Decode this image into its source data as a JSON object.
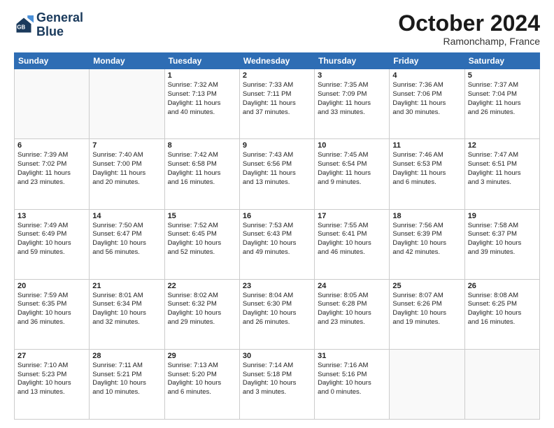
{
  "header": {
    "logo_line1": "General",
    "logo_line2": "Blue",
    "month": "October 2024",
    "location": "Ramonchamp, France"
  },
  "weekdays": [
    "Sunday",
    "Monday",
    "Tuesday",
    "Wednesday",
    "Thursday",
    "Friday",
    "Saturday"
  ],
  "weeks": [
    [
      {
        "day": "",
        "detail": ""
      },
      {
        "day": "",
        "detail": ""
      },
      {
        "day": "1",
        "detail": "Sunrise: 7:32 AM\nSunset: 7:13 PM\nDaylight: 11 hours\nand 40 minutes."
      },
      {
        "day": "2",
        "detail": "Sunrise: 7:33 AM\nSunset: 7:11 PM\nDaylight: 11 hours\nand 37 minutes."
      },
      {
        "day": "3",
        "detail": "Sunrise: 7:35 AM\nSunset: 7:09 PM\nDaylight: 11 hours\nand 33 minutes."
      },
      {
        "day": "4",
        "detail": "Sunrise: 7:36 AM\nSunset: 7:06 PM\nDaylight: 11 hours\nand 30 minutes."
      },
      {
        "day": "5",
        "detail": "Sunrise: 7:37 AM\nSunset: 7:04 PM\nDaylight: 11 hours\nand 26 minutes."
      }
    ],
    [
      {
        "day": "6",
        "detail": "Sunrise: 7:39 AM\nSunset: 7:02 PM\nDaylight: 11 hours\nand 23 minutes."
      },
      {
        "day": "7",
        "detail": "Sunrise: 7:40 AM\nSunset: 7:00 PM\nDaylight: 11 hours\nand 20 minutes."
      },
      {
        "day": "8",
        "detail": "Sunrise: 7:42 AM\nSunset: 6:58 PM\nDaylight: 11 hours\nand 16 minutes."
      },
      {
        "day": "9",
        "detail": "Sunrise: 7:43 AM\nSunset: 6:56 PM\nDaylight: 11 hours\nand 13 minutes."
      },
      {
        "day": "10",
        "detail": "Sunrise: 7:45 AM\nSunset: 6:54 PM\nDaylight: 11 hours\nand 9 minutes."
      },
      {
        "day": "11",
        "detail": "Sunrise: 7:46 AM\nSunset: 6:53 PM\nDaylight: 11 hours\nand 6 minutes."
      },
      {
        "day": "12",
        "detail": "Sunrise: 7:47 AM\nSunset: 6:51 PM\nDaylight: 11 hours\nand 3 minutes."
      }
    ],
    [
      {
        "day": "13",
        "detail": "Sunrise: 7:49 AM\nSunset: 6:49 PM\nDaylight: 10 hours\nand 59 minutes."
      },
      {
        "day": "14",
        "detail": "Sunrise: 7:50 AM\nSunset: 6:47 PM\nDaylight: 10 hours\nand 56 minutes."
      },
      {
        "day": "15",
        "detail": "Sunrise: 7:52 AM\nSunset: 6:45 PM\nDaylight: 10 hours\nand 52 minutes."
      },
      {
        "day": "16",
        "detail": "Sunrise: 7:53 AM\nSunset: 6:43 PM\nDaylight: 10 hours\nand 49 minutes."
      },
      {
        "day": "17",
        "detail": "Sunrise: 7:55 AM\nSunset: 6:41 PM\nDaylight: 10 hours\nand 46 minutes."
      },
      {
        "day": "18",
        "detail": "Sunrise: 7:56 AM\nSunset: 6:39 PM\nDaylight: 10 hours\nand 42 minutes."
      },
      {
        "day": "19",
        "detail": "Sunrise: 7:58 AM\nSunset: 6:37 PM\nDaylight: 10 hours\nand 39 minutes."
      }
    ],
    [
      {
        "day": "20",
        "detail": "Sunrise: 7:59 AM\nSunset: 6:35 PM\nDaylight: 10 hours\nand 36 minutes."
      },
      {
        "day": "21",
        "detail": "Sunrise: 8:01 AM\nSunset: 6:34 PM\nDaylight: 10 hours\nand 32 minutes."
      },
      {
        "day": "22",
        "detail": "Sunrise: 8:02 AM\nSunset: 6:32 PM\nDaylight: 10 hours\nand 29 minutes."
      },
      {
        "day": "23",
        "detail": "Sunrise: 8:04 AM\nSunset: 6:30 PM\nDaylight: 10 hours\nand 26 minutes."
      },
      {
        "day": "24",
        "detail": "Sunrise: 8:05 AM\nSunset: 6:28 PM\nDaylight: 10 hours\nand 23 minutes."
      },
      {
        "day": "25",
        "detail": "Sunrise: 8:07 AM\nSunset: 6:26 PM\nDaylight: 10 hours\nand 19 minutes."
      },
      {
        "day": "26",
        "detail": "Sunrise: 8:08 AM\nSunset: 6:25 PM\nDaylight: 10 hours\nand 16 minutes."
      }
    ],
    [
      {
        "day": "27",
        "detail": "Sunrise: 7:10 AM\nSunset: 5:23 PM\nDaylight: 10 hours\nand 13 minutes."
      },
      {
        "day": "28",
        "detail": "Sunrise: 7:11 AM\nSunset: 5:21 PM\nDaylight: 10 hours\nand 10 minutes."
      },
      {
        "day": "29",
        "detail": "Sunrise: 7:13 AM\nSunset: 5:20 PM\nDaylight: 10 hours\nand 6 minutes."
      },
      {
        "day": "30",
        "detail": "Sunrise: 7:14 AM\nSunset: 5:18 PM\nDaylight: 10 hours\nand 3 minutes."
      },
      {
        "day": "31",
        "detail": "Sunrise: 7:16 AM\nSunset: 5:16 PM\nDaylight: 10 hours\nand 0 minutes."
      },
      {
        "day": "",
        "detail": ""
      },
      {
        "day": "",
        "detail": ""
      }
    ]
  ]
}
